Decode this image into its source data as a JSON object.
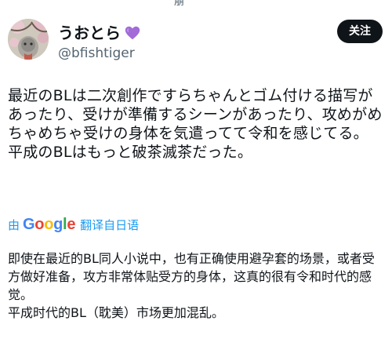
{
  "top_crop_text": "崩",
  "author": {
    "display_name": "うおとら",
    "handle": "@bfishtiger",
    "avatar": "avatar-image",
    "badge_icon": "purple-heart-icon"
  },
  "follow_button": {
    "label": "关注"
  },
  "tweet": {
    "text": "最近のBLは二次創作ですらちゃんとゴム付ける描写があったり、受けが準備するシーンがあったり、攻めがめちゃめちゃ受けの身体を気遣ってて令和を感じてる。\n平成のBLはもっと破茶滅茶だった。"
  },
  "translation": {
    "by_label": "由",
    "provider_letters": [
      "G",
      "o",
      "o",
      "g",
      "l",
      "e"
    ],
    "action_label": "翻译自日语",
    "text": "即使在最近的BL同人小说中，也有正确使用避孕套的场景，或者受方做好准备，攻方非常体贴受方的身体，这真的很有令和时代的感觉。\n平成时代的BL（耽美）市场更加混乱。"
  },
  "colors": {
    "google_blue": "#4285F4",
    "google_red": "#EA4335",
    "google_yellow": "#FBBC05",
    "google_green": "#34A853",
    "link_blue": "#1d9bf0",
    "heart_purple": "#a36bd8"
  }
}
